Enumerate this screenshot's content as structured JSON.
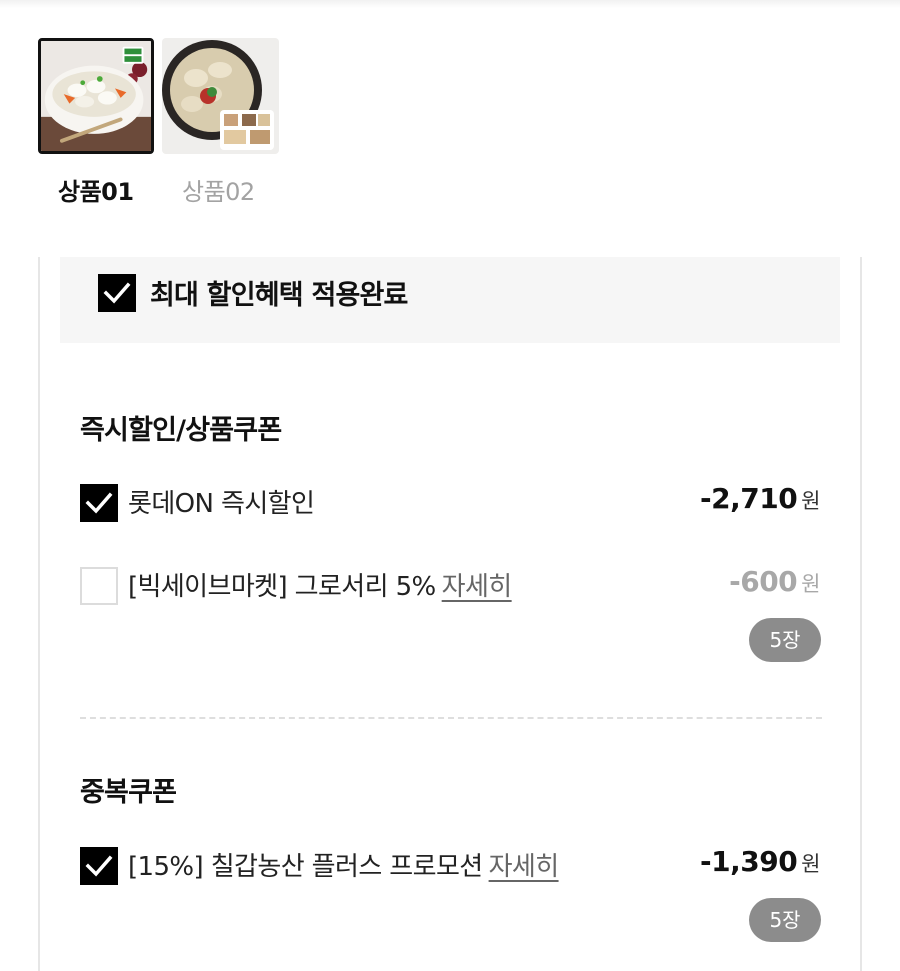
{
  "products": [
    {
      "label": "상품01",
      "selected": true,
      "icon": "dumpling-soup-bowl-photo"
    },
    {
      "label": "상품02",
      "selected": false,
      "icon": "dumpling-soup-pot-photo"
    }
  ],
  "max_discount": {
    "label": "최대 할인혜택 적용완료",
    "checked": true
  },
  "sections": [
    {
      "title": "즉시할인/상품쿠폰",
      "items": [
        {
          "label": "롯데ON 즉시할인",
          "detail": "",
          "amount": "-2,710",
          "unit": "원",
          "checked": true,
          "badge": ""
        },
        {
          "label": "[빅세이브마켓] 그로서리 5%",
          "detail": "자세히",
          "amount": "-600",
          "unit": "원",
          "checked": false,
          "badge": "5장"
        }
      ]
    },
    {
      "title": "중복쿠폰",
      "items": [
        {
          "label": "[15%] 칠갑농산 플러스 프로모션",
          "detail": "자세히",
          "amount": "-1,390",
          "unit": "원",
          "checked": true,
          "badge": "5장"
        }
      ]
    }
  ],
  "colors": {
    "checkbox_on": "#000000",
    "badge_bg": "#8c8c8c",
    "panel_bg": "#f6f6f6",
    "muted_text": "#a8a8a8"
  }
}
